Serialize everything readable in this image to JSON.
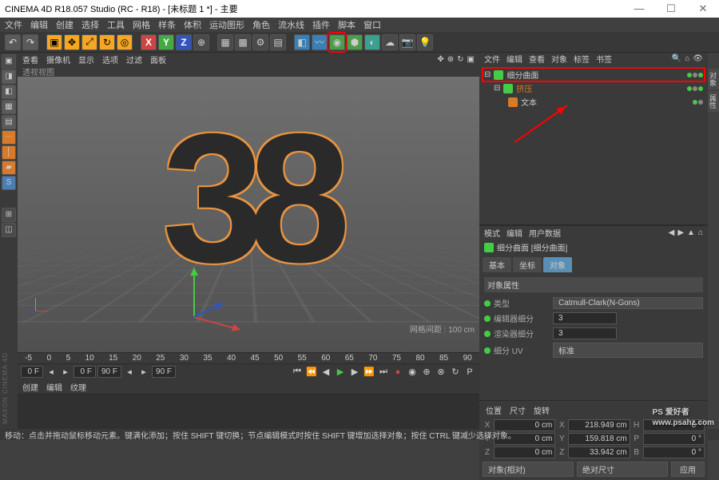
{
  "window": {
    "title": "CINEMA 4D R18.057 Studio (RC - R18) - [未标题 1 *] - 主要",
    "min": "—",
    "max": "☐",
    "close": "✕"
  },
  "menubar": [
    "文件",
    "编辑",
    "创建",
    "选择",
    "工具",
    "网格",
    "样条",
    "体积",
    "运动图形",
    "角色",
    "流水线",
    "插件",
    "脚本",
    "窗口"
  ],
  "toolbar_axes": {
    "x": "X",
    "y": "Y",
    "z": "Z"
  },
  "viewport": {
    "menus": [
      "查看",
      "摄像机",
      "显示",
      "选项",
      "过滤",
      "面板"
    ],
    "label": "透视视图",
    "footer": "网格间距 : 100 cm",
    "content": "38"
  },
  "ruler": [
    "-5",
    "0",
    "5",
    "10",
    "15",
    "20",
    "25",
    "30",
    "35",
    "40",
    "45",
    "50",
    "55",
    "60",
    "65",
    "70",
    "75",
    "80",
    "85",
    "90"
  ],
  "timeline": {
    "cur": "0 F",
    "start": "0 F",
    "end": "90 F",
    "total": "90 F"
  },
  "mat_tabs": [
    "创建",
    "编辑",
    "纹理"
  ],
  "objects": {
    "menus": [
      "文件",
      "编辑",
      "查看",
      "对象",
      "标签",
      "书签"
    ],
    "items": [
      {
        "name": "细分曲面",
        "icon": "g"
      },
      {
        "name": "挤压",
        "icon": "g"
      },
      {
        "name": "文本",
        "icon": "t"
      }
    ]
  },
  "attr": {
    "menus": [
      "模式",
      "编辑",
      "用户数据"
    ],
    "title": "细分曲面 [细分曲面]",
    "tabs": [
      "基本",
      "坐标",
      "对象"
    ],
    "section": "对象属性",
    "rows": {
      "type_label": "类型",
      "type_value": "Catmull-Clark(N-Gons)",
      "editor_label": "编辑器细分",
      "editor_value": "3",
      "render_label": "渲染器细分",
      "render_value": "3",
      "uv_label": "细分 UV",
      "uv_value": "标准"
    }
  },
  "coords": {
    "tabs": [
      "位置",
      "尺寸",
      "旋转"
    ],
    "X": "0 cm",
    "Y": "0 cm",
    "Z": "0 cm",
    "sX": "218.949 cm",
    "sY": "159.818 cm",
    "sZ": "33.942 cm",
    "rH": "0 °",
    "rP": "0 °",
    "rB": "0 °",
    "mode1": "对象(相对)",
    "mode2": "绝对尺寸",
    "apply": "应用"
  },
  "status": {
    "left": "移动：点击并拖动鼠标移动元素。键满化添加；按住 SHIFT 键切换；节点编辑模式时按住 SHIFT 键增加选择对象；按住 CTRL 键减少选择对象。",
    "right": ""
  },
  "watermark": {
    "brand": "PS 爱好者",
    "url": "www.psahz.com"
  },
  "brand_vert": "MAXON CINEMA 4D"
}
